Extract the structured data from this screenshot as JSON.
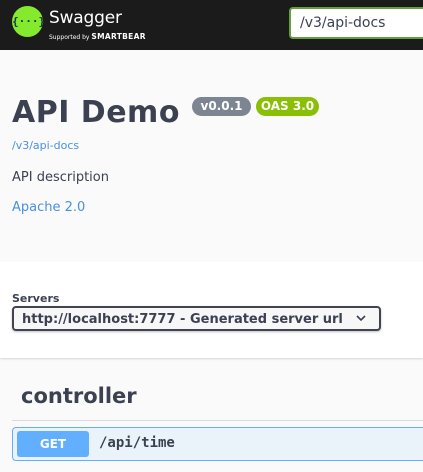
{
  "topbar": {
    "logo_icon_text": "{···}",
    "logo_word": "Swagger",
    "logo_sub_prefix": "Supported by",
    "logo_sub_brand": "SMARTBEAR",
    "url_value": "/v3/api-docs"
  },
  "info": {
    "title": "API Demo",
    "version_badge": "v0.0.1",
    "oas_badge": "OAS 3.0",
    "spec_link": "/v3/api-docs",
    "description": "API description",
    "license": "Apache 2.0"
  },
  "servers": {
    "label": "Servers",
    "selected": "http://localhost:7777 - Generated server url"
  },
  "tags": [
    {
      "name": "controller",
      "operations": [
        {
          "method": "GET",
          "path": "/api/time"
        }
      ]
    }
  ],
  "colors": {
    "topbar": "#1b1b1b",
    "logo_green": "#85ea2d",
    "input_border": "#62a03f",
    "version_badge": "#7d8492",
    "oas_badge": "#89bf04",
    "link": "#4990e2",
    "get_method": "#61affe",
    "text": "#3b4151"
  },
  "icons": {
    "logo": "swagger-logo-icon",
    "select_arrow": "chevron-down-icon"
  }
}
